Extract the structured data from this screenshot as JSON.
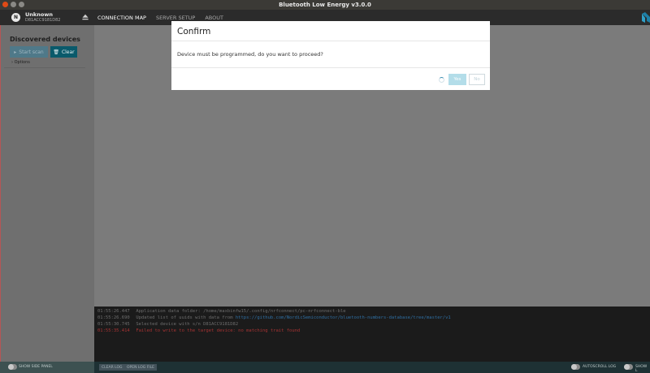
{
  "window": {
    "title": "Bluetooth Low Energy v3.0.0"
  },
  "device": {
    "avatar_letter": "N",
    "name": "Unknown",
    "serial": "D81ACC9181D82"
  },
  "nav": {
    "tabs": [
      {
        "label": "CONNECTION MAP",
        "active": true
      },
      {
        "label": "SERVER SETUP",
        "active": false
      },
      {
        "label": "ABOUT",
        "active": false
      }
    ]
  },
  "side_panel": {
    "title": "Discovered devices",
    "start_scan_label": "Start scan",
    "clear_label": "Clear",
    "options_label": "Options"
  },
  "log": {
    "entries": [
      {
        "time": "01:55:26.447",
        "message": "Application data folder: /home/maxbinfw15/.config/nrfconnect/pc-nrfconnect-ble",
        "level": "info"
      },
      {
        "time": "01:55:26.690",
        "message": "Updated list of uuids with data from ",
        "link": "https://github.com/NordicSemiconductor/bluetooth-numbers-database/tree/master/v1",
        "level": "info"
      },
      {
        "time": "01:55:30.745",
        "message": "Selected device with s/n D81ACC9181D82",
        "level": "info"
      },
      {
        "time": "01:55:35.414",
        "message": "Failed to write to the target device: no matching trait found",
        "level": "error"
      }
    ]
  },
  "footer": {
    "show_side_panel_label": "SHOW SIDE PANEL",
    "clear_log_label": "CLEAR LOG",
    "open_log_file_label": "OPEN LOG FILE",
    "autoscroll_label": "AUTOSCROLL LOG",
    "show_log_label": "SHOW L"
  },
  "modal": {
    "title": "Confirm",
    "message": "Device must be programmed, do you want to proceed?",
    "yes_label": "Yes",
    "no_label": "No"
  },
  "colors": {
    "accent": "#0a5a6b",
    "error": "#a73333",
    "link": "#2f6fa3"
  }
}
